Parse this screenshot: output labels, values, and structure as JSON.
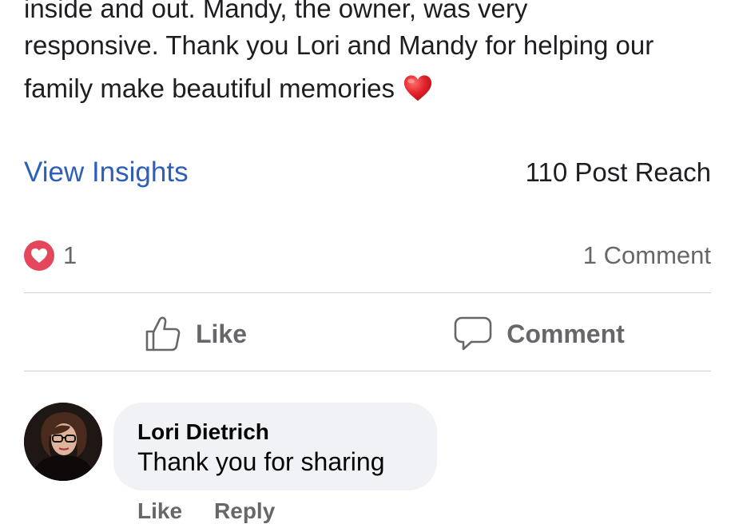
{
  "post": {
    "text_lines": [
      "inside and out. Mandy, the owner, was very",
      "responsive. Thank you Lori and Mandy for helping our",
      "family make beautiful memories"
    ],
    "emoji": "red-heart-emoji"
  },
  "insights": {
    "view_label": "View Insights",
    "reach_label": "110 Post Reach"
  },
  "reactions": {
    "count": "1",
    "comment_count_label": "1 Comment"
  },
  "actions": {
    "like_label": "Like",
    "comment_label": "Comment"
  },
  "comment": {
    "author": "Lori Dietrich",
    "text": "Thank you for sharing",
    "like_label": "Like",
    "reply_label": "Reply"
  },
  "colors": {
    "link_blue": "#2d5fb8",
    "love_red": "#e4465b",
    "muted_gray": "#65676b",
    "bubble_bg": "#f0f2f5"
  }
}
